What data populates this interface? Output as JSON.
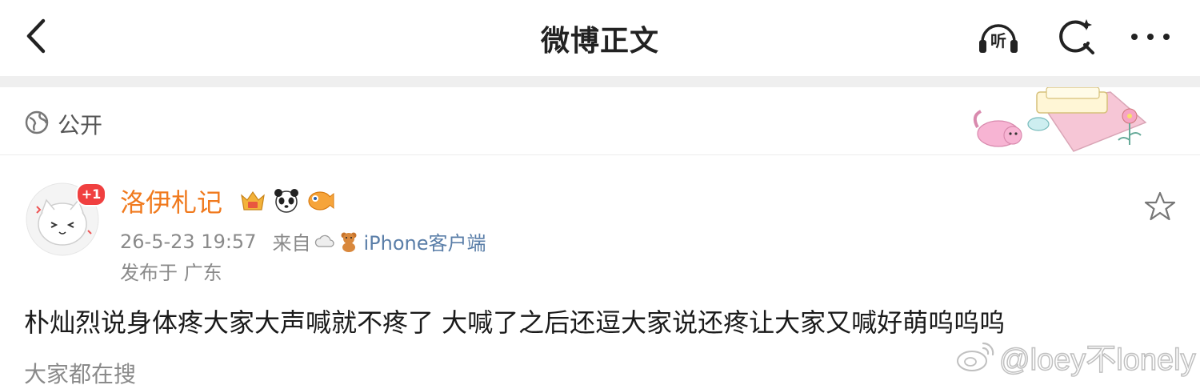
{
  "header": {
    "title": "微博正文",
    "listen_label": "听"
  },
  "visibility": {
    "label": "公开"
  },
  "post": {
    "badge": "+1",
    "username": "洛伊札记",
    "time": "26-5-23 19:57",
    "from_label": "来自",
    "source": "iPhone客户端",
    "location": "发布于 广东",
    "text": "朴灿烈说身体疼大家大声喊就不疼了 大喊了之后还逗大家说还疼让大家又喊好萌呜呜呜"
  },
  "trending": {
    "label": "大家都在搜"
  },
  "watermark": {
    "text": "@loey不lonely"
  },
  "colors": {
    "username": "#f07a1e",
    "source_link": "#5a7ea8",
    "badge": "#f04040"
  }
}
